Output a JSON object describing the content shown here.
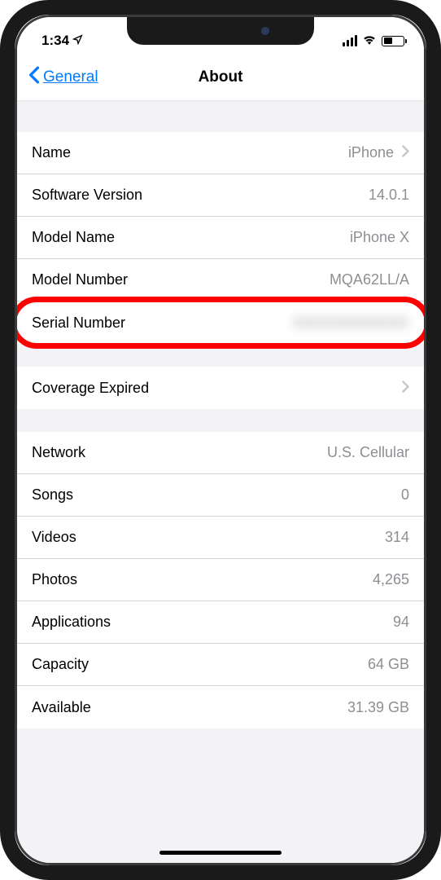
{
  "statusBar": {
    "time": "1:34"
  },
  "nav": {
    "backLabel": "General",
    "title": "About"
  },
  "section1": {
    "name": {
      "label": "Name",
      "value": "iPhone"
    },
    "softwareVersion": {
      "label": "Software Version",
      "value": "14.0.1"
    },
    "modelName": {
      "label": "Model Name",
      "value": "iPhone X"
    },
    "modelNumber": {
      "label": "Model Number",
      "value": "MQA62LL/A"
    },
    "serialNumber": {
      "label": "Serial Number",
      "value": "XXXXXXXXXXX"
    }
  },
  "section2": {
    "coverage": {
      "label": "Coverage Expired"
    }
  },
  "section3": {
    "network": {
      "label": "Network",
      "value": "U.S. Cellular"
    },
    "songs": {
      "label": "Songs",
      "value": "0"
    },
    "videos": {
      "label": "Videos",
      "value": "314"
    },
    "photos": {
      "label": "Photos",
      "value": "4,265"
    },
    "applications": {
      "label": "Applications",
      "value": "94"
    },
    "capacity": {
      "label": "Capacity",
      "value": "64 GB"
    },
    "available": {
      "label": "Available",
      "value": "31.39 GB"
    }
  }
}
